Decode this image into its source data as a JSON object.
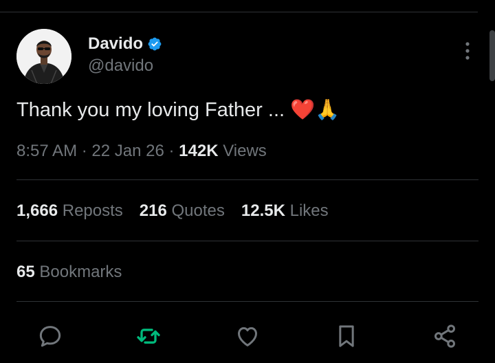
{
  "tweet": {
    "author": {
      "display_name": "Davido",
      "handle": "@davido",
      "verified": true,
      "avatar_icon": "profile-photo"
    },
    "text": "Thank you my loving Father ... ❤️🙏",
    "time": "8:57 AM",
    "date": "22 Jan 26",
    "separator": "·",
    "views_count": "142K",
    "views_label": "Views"
  },
  "stats": {
    "reposts": {
      "count": "1,666",
      "label": "Reposts"
    },
    "quotes": {
      "count": "216",
      "label": "Quotes"
    },
    "likes": {
      "count": "12.5K",
      "label": "Likes"
    },
    "bookmarks": {
      "count": "65",
      "label": "Bookmarks"
    }
  },
  "actions": [
    {
      "name": "reply",
      "icon": "reply-icon"
    },
    {
      "name": "repost",
      "icon": "repost-icon",
      "active": true
    },
    {
      "name": "like",
      "icon": "heart-icon"
    },
    {
      "name": "bookmark",
      "icon": "bookmark-icon"
    },
    {
      "name": "share",
      "icon": "share-icon"
    }
  ],
  "colors": {
    "background": "#000000",
    "text_primary": "#e7e9ea",
    "text_secondary": "#71767b",
    "divider": "#2f3336",
    "verified_blue": "#1d9bf0",
    "repost_green": "#00ba7c",
    "icon_gray": "#71767b"
  },
  "more_menu_icon": "more-vertical-icon"
}
